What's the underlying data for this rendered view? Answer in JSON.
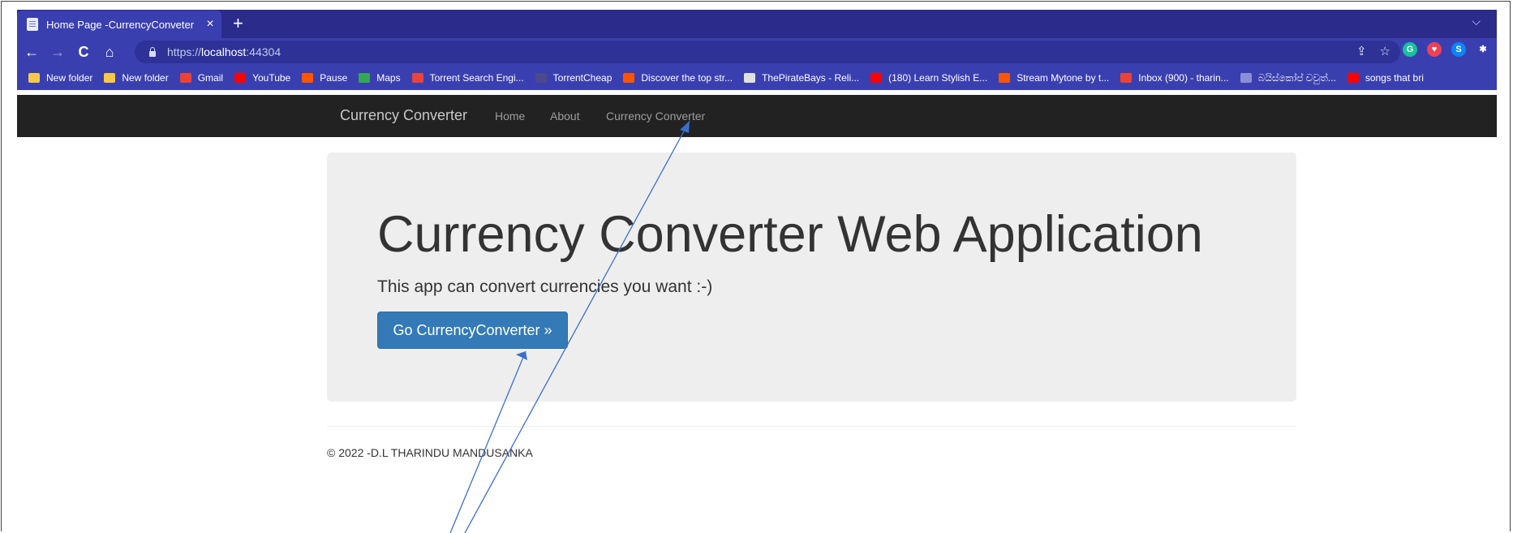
{
  "browser": {
    "tab_title": "Home Page -CurrencyConveter",
    "tab_close": "×",
    "new_tab": "+",
    "tab_menu": "⌵",
    "nav": {
      "back": "←",
      "forward": "→",
      "reload": "C",
      "home": "⌂"
    },
    "url_scheme": "https://",
    "url_host": "localhost",
    "url_port": ":44304",
    "omni_icons": [
      "share-icon",
      "star-icon"
    ],
    "extensions": [
      {
        "name": "grammarly-icon",
        "label": "G",
        "color": "#15c39a"
      },
      {
        "name": "pocket-icon",
        "label": "♥",
        "color": "#ef4056"
      },
      {
        "name": "shazam-icon",
        "label": "S",
        "color": "#0a84ff"
      },
      {
        "name": "puzzle-icon",
        "label": "✱",
        "color": "#3a3fb0"
      }
    ],
    "bookmarks": [
      {
        "label": "New folder",
        "color": "#f6c94a"
      },
      {
        "label": "New folder",
        "color": "#f6c94a"
      },
      {
        "label": "Gmail",
        "color": "#ea4335"
      },
      {
        "label": "YouTube",
        "color": "#ff0000"
      },
      {
        "label": "Pause",
        "color": "#ff5500"
      },
      {
        "label": "Maps",
        "color": "#34a853"
      },
      {
        "label": "Torrent Search Engi...",
        "color": "#e8453c"
      },
      {
        "label": "TorrentCheap",
        "color": "#4a4a8c"
      },
      {
        "label": "Discover the top str...",
        "color": "#ff5500"
      },
      {
        "label": "ThePirateBays - Reli...",
        "color": "#e0e0e0"
      },
      {
        "label": "(180) Learn Stylish E...",
        "color": "#ff0000"
      },
      {
        "label": "Stream Mytone by t...",
        "color": "#ff5500"
      },
      {
        "label": "Inbox (900) - tharin...",
        "color": "#ea4335"
      },
      {
        "label": "බයිස්කෝප් චවුත්...",
        "color": "#8a8fd8"
      },
      {
        "label": "songs that bri",
        "color": "#ff0000"
      }
    ]
  },
  "site": {
    "brand": "Currency Converter",
    "nav": [
      "Home",
      "About",
      "Currency Converter"
    ],
    "heading": "Currency Converter Web Application",
    "lead": "This app can convert currencies you want :-)",
    "button": "Go CurrencyConverter »",
    "footer": "© 2022 -D.L THARINDU MANDUSANKA"
  },
  "colors": {
    "chrome_dark": "#2b2b8c",
    "chrome": "#3a3fb0",
    "navbar": "#222222",
    "jumbotron": "#eeeeee",
    "button": "#337ab7",
    "annotation": "#3b6fc9"
  }
}
